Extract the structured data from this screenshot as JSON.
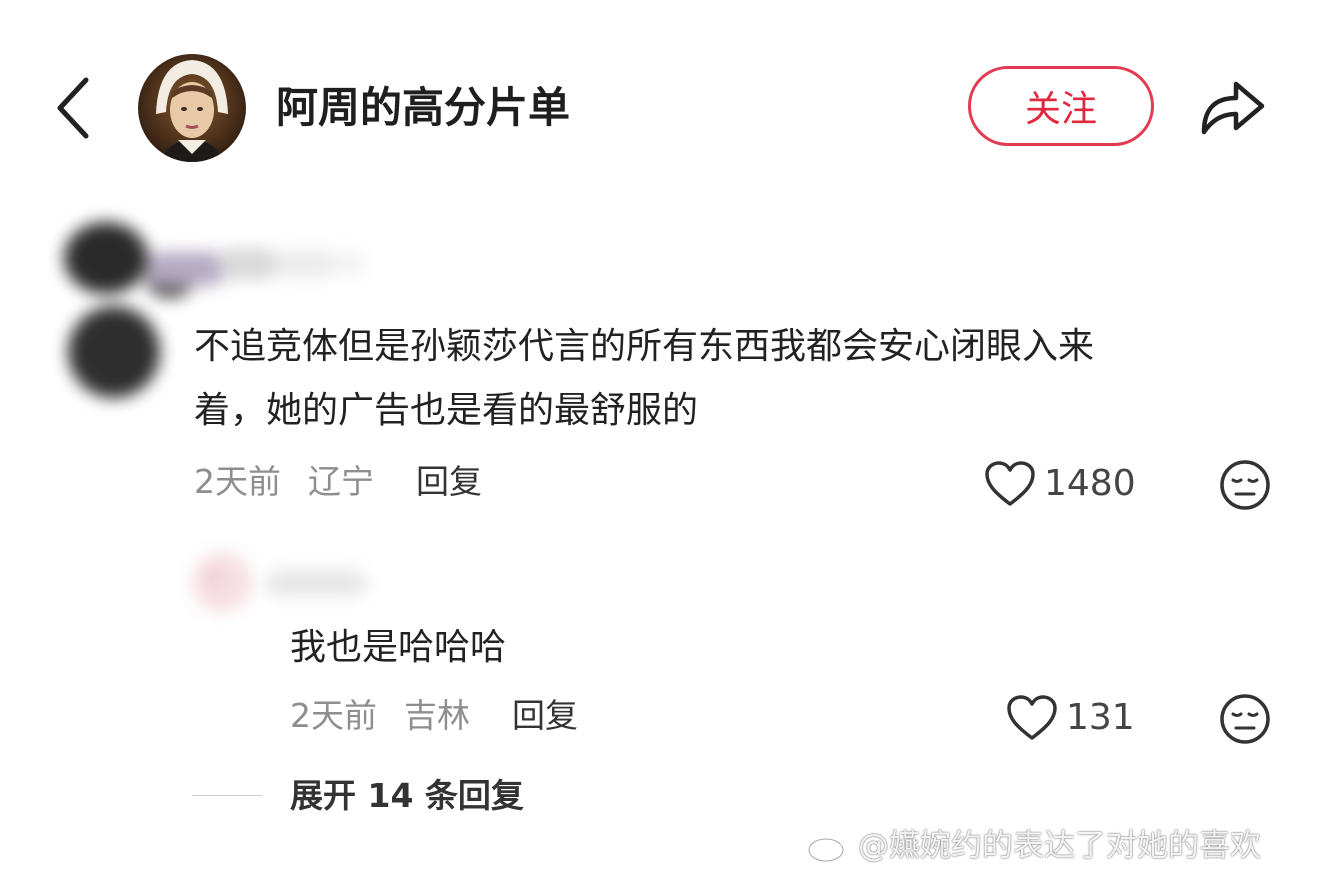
{
  "header": {
    "author_name": "阿周的高分片单",
    "follow_label": "关注"
  },
  "comments": [
    {
      "text_line1": "不追竞体但是孙颖莎代言的所有东西我都会安心闭眼入来",
      "text_line2": "着，她的广告也是看的最舒服的",
      "time": "2天前",
      "location": "辽宁",
      "reply_label": "回复",
      "likes": "1480"
    }
  ],
  "replies": [
    {
      "text": "我也是哈哈哈",
      "time": "2天前",
      "location": "吉林",
      "reply_label": "回复",
      "likes": "131"
    }
  ],
  "expand_label": "展开 14 条回复",
  "watermark": "@嬿婉约的表达了对她的喜欢",
  "icons": {
    "back": "chevron-left-icon",
    "share": "share-arrow-icon",
    "like": "heart-outline-icon",
    "dislike": "neutral-face-icon",
    "watermark": "weibo-logo-icon"
  },
  "colors": {
    "accent": "#e0283f",
    "text": "#222222",
    "muted": "#8e8e8e"
  }
}
